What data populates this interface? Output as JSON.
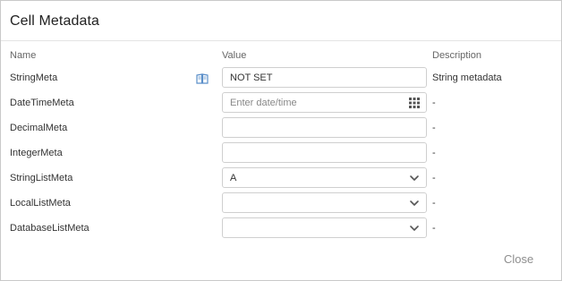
{
  "dialog": {
    "title": "Cell Metadata",
    "close_label": "Close"
  },
  "columns": {
    "name": "Name",
    "value": "Value",
    "description": "Description"
  },
  "rows": [
    {
      "name": "StringMeta",
      "type": "text",
      "value": "NOT SET",
      "description": "String metadata",
      "has_book_icon": true
    },
    {
      "name": "DateTimeMeta",
      "type": "datetime",
      "placeholder": "Enter date/time",
      "value": "",
      "description": "-"
    },
    {
      "name": "DecimalMeta",
      "type": "text",
      "value": "",
      "description": "-"
    },
    {
      "name": "IntegerMeta",
      "type": "text",
      "value": "",
      "description": "-"
    },
    {
      "name": "StringListMeta",
      "type": "select",
      "value": "A",
      "description": "-"
    },
    {
      "name": "LocalListMeta",
      "type": "select",
      "value": "",
      "description": "-"
    },
    {
      "name": "DatabaseListMeta",
      "type": "select",
      "value": "",
      "description": "-"
    }
  ],
  "icons": {
    "book": "book-icon",
    "calendar": "calendar-grid-icon",
    "chevron": "chevron-down-icon"
  },
  "colors": {
    "border": "#cfcfcf",
    "icon_blue": "#5b8fc9",
    "close_text": "#8e8e8e"
  }
}
